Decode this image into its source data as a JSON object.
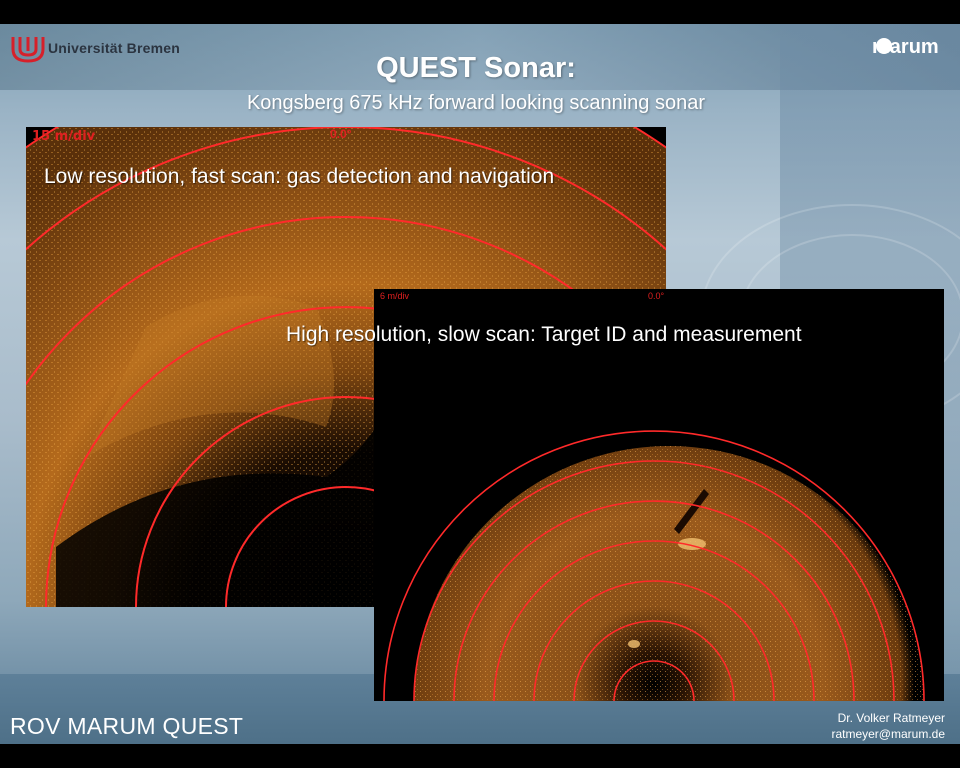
{
  "header": {
    "university_name": "Universität Bremen",
    "marum_logo_text": "marum",
    "title": "QUEST Sonar:",
    "subtitle": "Kongsberg 675 kHz forward looking scanning sonar"
  },
  "low_res_panel": {
    "scale_label": "15 m/div",
    "angle_label": "0.0°",
    "caption": "Low resolution, fast scan: gas detection and navigation"
  },
  "high_res_panel": {
    "scale_label": "6 m/div",
    "angle_label": "0.0°",
    "caption": "High resolution, slow scan: Target ID and measurement"
  },
  "footer": {
    "title": "ROV MARUM QUEST",
    "author_name": "Dr. Volker Ratmeyer",
    "author_email": "ratmeyer@marum.de"
  },
  "colors": {
    "sonar_echo": "#c8781e",
    "range_rings": "#ff2a2a",
    "slide_background": "#9ab3c5"
  },
  "icons": [
    "universitaet-bremen-logo",
    "marum-logo"
  ]
}
